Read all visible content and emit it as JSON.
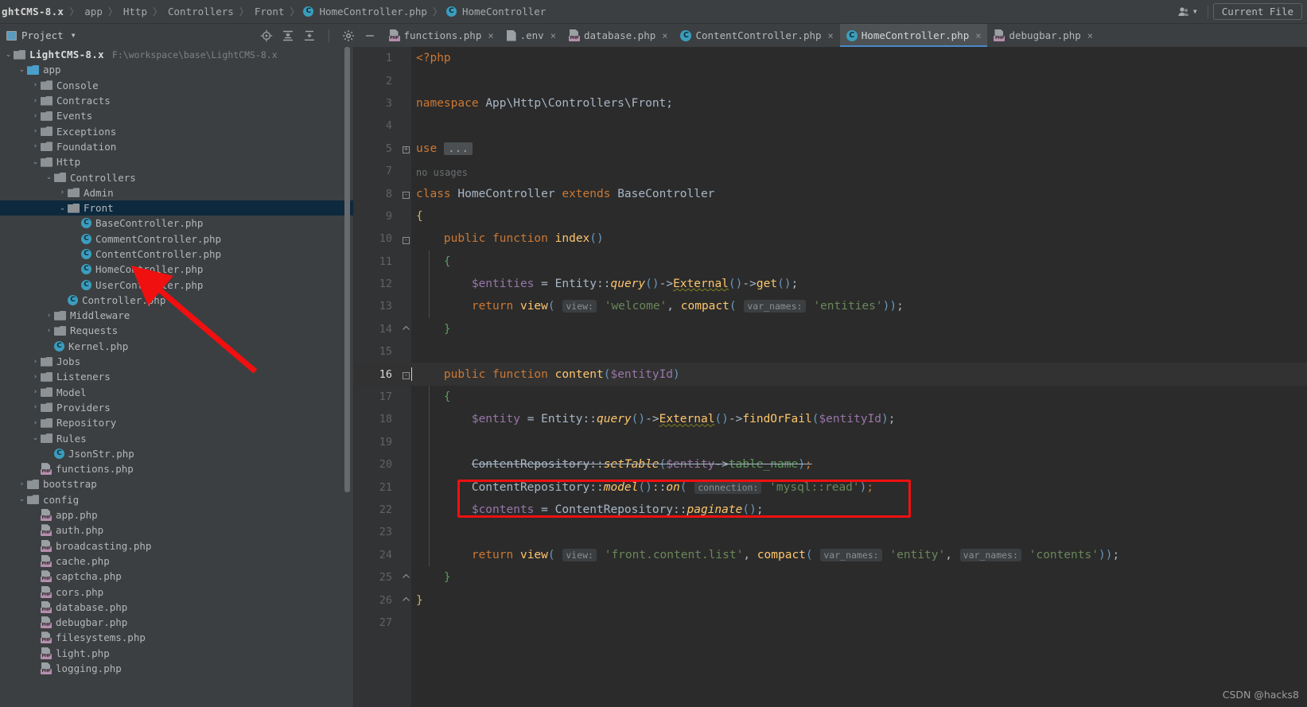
{
  "breadcrumb": {
    "items": [
      {
        "label": "ghtCMS-8.x",
        "icon": "none",
        "root": true
      },
      {
        "label": "app",
        "icon": "none"
      },
      {
        "label": "Http",
        "icon": "none"
      },
      {
        "label": "Controllers",
        "icon": "none"
      },
      {
        "label": "Front",
        "icon": "none"
      },
      {
        "label": "HomeController.php",
        "icon": "class-icon"
      },
      {
        "label": "HomeController",
        "icon": "class-icon"
      }
    ],
    "separator": "〉",
    "current_file_label": "Current File"
  },
  "toolbar": {
    "project_label": "Project",
    "project_caret": "▼",
    "icons": [
      "locate-icon",
      "expand-all-icon",
      "collapse-all-icon",
      "gear-icon",
      "minimize-icon"
    ]
  },
  "tabs": [
    {
      "label": "functions.php",
      "icon": "php-icon",
      "active": false,
      "close": "×"
    },
    {
      "label": ".env",
      "icon": "file-icon",
      "active": false,
      "close": "×"
    },
    {
      "label": "database.php",
      "icon": "php-icon",
      "active": false,
      "close": "×"
    },
    {
      "label": "ContentController.php",
      "icon": "class-icon",
      "active": false,
      "close": "×"
    },
    {
      "label": "HomeController.php",
      "icon": "class-icon",
      "active": true,
      "close": "×"
    },
    {
      "label": "debugbar.php",
      "icon": "php-icon",
      "active": false,
      "close": "×"
    }
  ],
  "tree": {
    "root_label": "LightCMS-8.x",
    "root_path": "F:\\workspace\\base\\LightCMS-8.x",
    "nodes": [
      {
        "label": "app",
        "type": "folder-blue",
        "indent": 1,
        "arrow": "⌄"
      },
      {
        "label": "Console",
        "type": "folder",
        "indent": 2,
        "arrow": "›"
      },
      {
        "label": "Contracts",
        "type": "folder",
        "indent": 2,
        "arrow": "›"
      },
      {
        "label": "Events",
        "type": "folder",
        "indent": 2,
        "arrow": "›"
      },
      {
        "label": "Exceptions",
        "type": "folder",
        "indent": 2,
        "arrow": "›"
      },
      {
        "label": "Foundation",
        "type": "folder",
        "indent": 2,
        "arrow": "›"
      },
      {
        "label": "Http",
        "type": "folder",
        "indent": 2,
        "arrow": "⌄"
      },
      {
        "label": "Controllers",
        "type": "folder",
        "indent": 3,
        "arrow": "⌄"
      },
      {
        "label": "Admin",
        "type": "folder",
        "indent": 4,
        "arrow": "›"
      },
      {
        "label": "Front",
        "type": "folder",
        "indent": 4,
        "arrow": "⌄",
        "selected": true
      },
      {
        "label": "BaseController.php",
        "type": "class",
        "indent": 5,
        "arrow": ""
      },
      {
        "label": "CommentController.php",
        "type": "class",
        "indent": 5,
        "arrow": ""
      },
      {
        "label": "ContentController.php",
        "type": "class",
        "indent": 5,
        "arrow": ""
      },
      {
        "label": "HomeController.php",
        "type": "class",
        "indent": 5,
        "arrow": ""
      },
      {
        "label": "UserController.php",
        "type": "class",
        "indent": 5,
        "arrow": ""
      },
      {
        "label": "Controller.php",
        "type": "class",
        "indent": 4,
        "arrow": ""
      },
      {
        "label": "Middleware",
        "type": "folder",
        "indent": 3,
        "arrow": "›"
      },
      {
        "label": "Requests",
        "type": "folder",
        "indent": 3,
        "arrow": "›"
      },
      {
        "label": "Kernel.php",
        "type": "class",
        "indent": 3,
        "arrow": ""
      },
      {
        "label": "Jobs",
        "type": "folder",
        "indent": 2,
        "arrow": "›"
      },
      {
        "label": "Listeners",
        "type": "folder",
        "indent": 2,
        "arrow": "›"
      },
      {
        "label": "Model",
        "type": "folder",
        "indent": 2,
        "arrow": "›"
      },
      {
        "label": "Providers",
        "type": "folder",
        "indent": 2,
        "arrow": "›"
      },
      {
        "label": "Repository",
        "type": "folder",
        "indent": 2,
        "arrow": "›"
      },
      {
        "label": "Rules",
        "type": "folder",
        "indent": 2,
        "arrow": "⌄"
      },
      {
        "label": "JsonStr.php",
        "type": "class",
        "indent": 3,
        "arrow": ""
      },
      {
        "label": "functions.php",
        "type": "php",
        "indent": 2,
        "arrow": ""
      },
      {
        "label": "bootstrap",
        "type": "folder",
        "indent": 1,
        "arrow": "›"
      },
      {
        "label": "config",
        "type": "folder",
        "indent": 1,
        "arrow": "⌄"
      },
      {
        "label": "app.php",
        "type": "php",
        "indent": 2,
        "arrow": ""
      },
      {
        "label": "auth.php",
        "type": "php",
        "indent": 2,
        "arrow": ""
      },
      {
        "label": "broadcasting.php",
        "type": "php",
        "indent": 2,
        "arrow": ""
      },
      {
        "label": "cache.php",
        "type": "php",
        "indent": 2,
        "arrow": ""
      },
      {
        "label": "captcha.php",
        "type": "php",
        "indent": 2,
        "arrow": ""
      },
      {
        "label": "cors.php",
        "type": "php",
        "indent": 2,
        "arrow": ""
      },
      {
        "label": "database.php",
        "type": "php",
        "indent": 2,
        "arrow": ""
      },
      {
        "label": "debugbar.php",
        "type": "php",
        "indent": 2,
        "arrow": ""
      },
      {
        "label": "filesystems.php",
        "type": "php",
        "indent": 2,
        "arrow": ""
      },
      {
        "label": "light.php",
        "type": "php",
        "indent": 2,
        "arrow": ""
      },
      {
        "label": "logging.php",
        "type": "php",
        "indent": 2,
        "arrow": ""
      }
    ]
  },
  "editor": {
    "filename": "HomeController.php",
    "current_line": 16,
    "inlay_hints": {
      "view": "view:",
      "var_names": "var_names:",
      "connection": "connection:"
    },
    "usage_hint": "no usages",
    "ellipsis": "...",
    "line_numbers": [
      1,
      2,
      3,
      4,
      5,
      7,
      8,
      9,
      10,
      11,
      12,
      13,
      14,
      15,
      16,
      17,
      18,
      19,
      20,
      21,
      22,
      23,
      24,
      25,
      26,
      27
    ],
    "lines": [
      {
        "n": 1,
        "text": "<?php"
      },
      {
        "n": 2,
        "text": ""
      },
      {
        "n": 3,
        "text": "namespace App\\Http\\Controllers\\Front;"
      },
      {
        "n": 4,
        "text": ""
      },
      {
        "n": 5,
        "text": "use ..."
      },
      {
        "n": 7,
        "text": ""
      },
      {
        "n": 8,
        "text": "class HomeController extends BaseController"
      },
      {
        "n": 9,
        "text": "{"
      },
      {
        "n": 10,
        "text": "    public function index()"
      },
      {
        "n": 11,
        "text": "    {"
      },
      {
        "n": 12,
        "text": "        $entities = Entity::query()->External()->get();"
      },
      {
        "n": 13,
        "text": "        return view( view: 'welcome', compact( var_names: 'entities'));"
      },
      {
        "n": 14,
        "text": "    }"
      },
      {
        "n": 15,
        "text": ""
      },
      {
        "n": 16,
        "text": "    public function content($entityId)"
      },
      {
        "n": 17,
        "text": "    {"
      },
      {
        "n": 18,
        "text": "        $entity = Entity::query()->External()->findOrFail($entityId);"
      },
      {
        "n": 19,
        "text": ""
      },
      {
        "n": 20,
        "text": "        ContentRepository::setTable($entity->table_name);"
      },
      {
        "n": 21,
        "text": "        ContentRepository::model()::on( connection: 'mysql::read');"
      },
      {
        "n": 22,
        "text": "        $contents = ContentRepository::paginate();"
      },
      {
        "n": 23,
        "text": ""
      },
      {
        "n": 24,
        "text": "        return view( view: 'front.content.list', compact( var_names: 'entity', var_names: 'contents'));"
      },
      {
        "n": 25,
        "text": "    }"
      },
      {
        "n": 26,
        "text": "}"
      },
      {
        "n": 27,
        "text": ""
      }
    ]
  },
  "annotations": {
    "red_box_target_line": 21,
    "red_arrow_label": "",
    "accent_red": "#f01010"
  },
  "watermark": "CSDN @hacks8"
}
